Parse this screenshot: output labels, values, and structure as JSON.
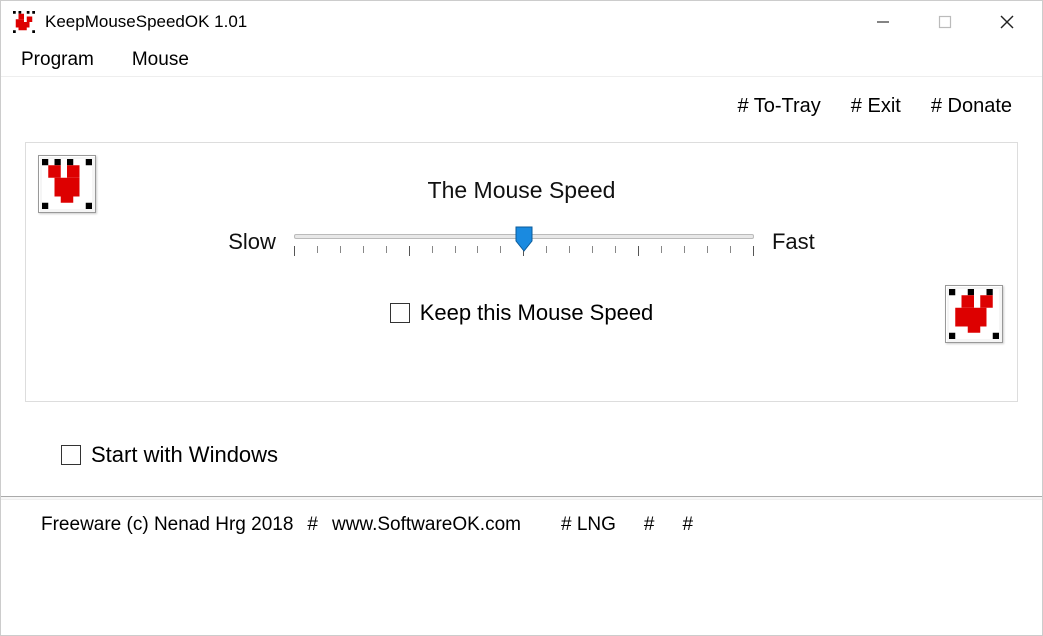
{
  "window": {
    "title": "KeepMouseSpeedOK 1.01"
  },
  "menu": {
    "program": "Program",
    "mouse": "Mouse"
  },
  "links": {
    "to_tray": "# To-Tray",
    "exit": "# Exit",
    "donate": "# Donate"
  },
  "panel": {
    "title": "The Mouse Speed",
    "slow": "Slow",
    "fast": "Fast",
    "keep_label": "Keep this Mouse Speed",
    "keep_checked": false,
    "slider_value": 10,
    "slider_min": 0,
    "slider_max": 20
  },
  "start": {
    "label": "Start with Windows",
    "checked": false
  },
  "footer": {
    "copyright": "Freeware (c) Nenad Hrg 2018",
    "site": "www.SoftwareOK.com",
    "lng": "# LNG",
    "hash1": "#",
    "hash2": "#",
    "sep": "#"
  }
}
